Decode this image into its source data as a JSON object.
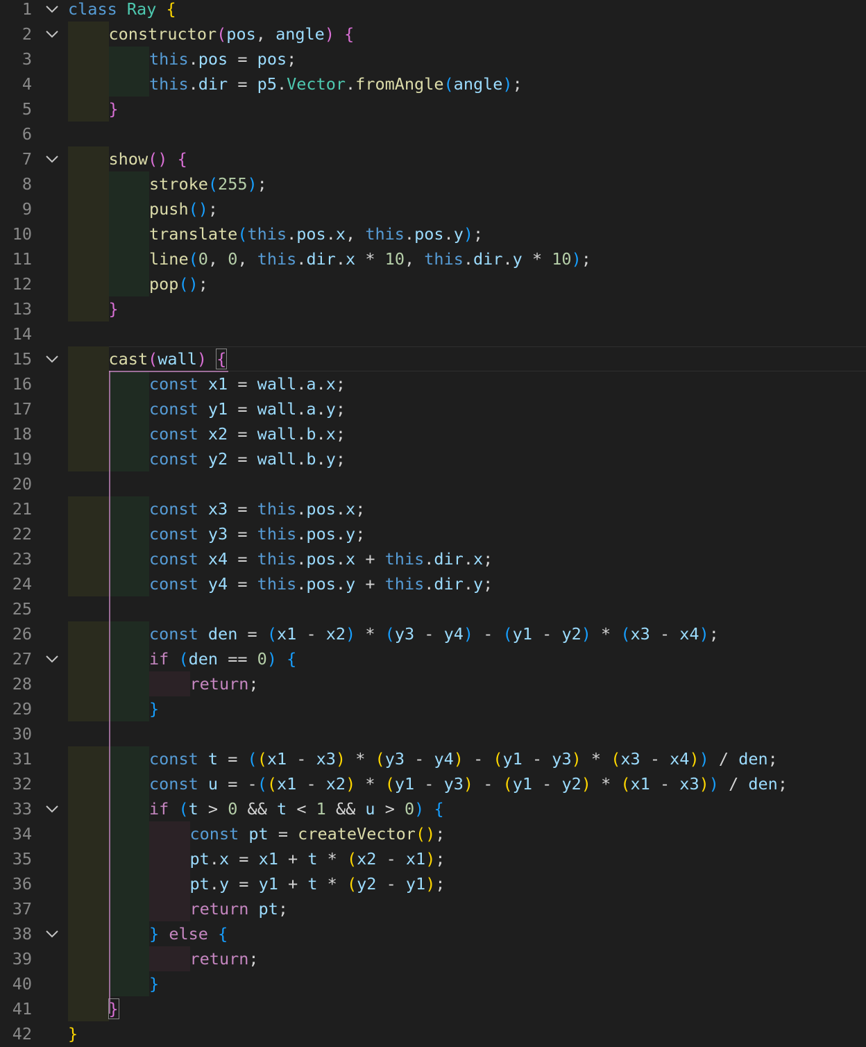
{
  "editor": {
    "lines": [
      {
        "n": "1",
        "fold": true,
        "indent": 0,
        "code": "class Ray {"
      },
      {
        "n": "2",
        "fold": true,
        "indent": 1,
        "code": "constructor(pos, angle) {"
      },
      {
        "n": "3",
        "fold": false,
        "indent": 2,
        "code": "this.pos = pos;"
      },
      {
        "n": "4",
        "fold": false,
        "indent": 2,
        "code": "this.dir = p5.Vector.fromAngle(angle);"
      },
      {
        "n": "5",
        "fold": false,
        "indent": 1,
        "code": "}"
      },
      {
        "n": "6",
        "fold": false,
        "indent": 0,
        "code": ""
      },
      {
        "n": "7",
        "fold": true,
        "indent": 1,
        "code": "show() {"
      },
      {
        "n": "8",
        "fold": false,
        "indent": 2,
        "code": "stroke(255);"
      },
      {
        "n": "9",
        "fold": false,
        "indent": 2,
        "code": "push();"
      },
      {
        "n": "10",
        "fold": false,
        "indent": 2,
        "code": "translate(this.pos.x, this.pos.y);"
      },
      {
        "n": "11",
        "fold": false,
        "indent": 2,
        "code": "line(0, 0, this.dir.x * 10, this.dir.y * 10);"
      },
      {
        "n": "12",
        "fold": false,
        "indent": 2,
        "code": "pop();"
      },
      {
        "n": "13",
        "fold": false,
        "indent": 1,
        "code": "}"
      },
      {
        "n": "14",
        "fold": false,
        "indent": 0,
        "code": ""
      },
      {
        "n": "15",
        "fold": true,
        "indent": 1,
        "code": "cast(wall) {"
      },
      {
        "n": "16",
        "fold": false,
        "indent": 2,
        "code": "const x1 = wall.a.x;"
      },
      {
        "n": "17",
        "fold": false,
        "indent": 2,
        "code": "const y1 = wall.a.y;"
      },
      {
        "n": "18",
        "fold": false,
        "indent": 2,
        "code": "const x2 = wall.b.x;"
      },
      {
        "n": "19",
        "fold": false,
        "indent": 2,
        "code": "const y2 = wall.b.y;"
      },
      {
        "n": "20",
        "fold": false,
        "indent": 0,
        "code": ""
      },
      {
        "n": "21",
        "fold": false,
        "indent": 2,
        "code": "const x3 = this.pos.x;"
      },
      {
        "n": "22",
        "fold": false,
        "indent": 2,
        "code": "const y3 = this.pos.y;"
      },
      {
        "n": "23",
        "fold": false,
        "indent": 2,
        "code": "const x4 = this.pos.x + this.dir.x;"
      },
      {
        "n": "24",
        "fold": false,
        "indent": 2,
        "code": "const y4 = this.pos.y + this.dir.y;"
      },
      {
        "n": "25",
        "fold": false,
        "indent": 0,
        "code": ""
      },
      {
        "n": "26",
        "fold": false,
        "indent": 2,
        "code": "const den = (x1 - x2) * (y3 - y4) - (y1 - y2) * (x3 - x4);"
      },
      {
        "n": "27",
        "fold": true,
        "indent": 2,
        "code": "if (den == 0) {"
      },
      {
        "n": "28",
        "fold": false,
        "indent": 3,
        "code": "return;"
      },
      {
        "n": "29",
        "fold": false,
        "indent": 2,
        "code": "}"
      },
      {
        "n": "30",
        "fold": false,
        "indent": 0,
        "code": ""
      },
      {
        "n": "31",
        "fold": false,
        "indent": 2,
        "code": "const t = ((x1 - x3) * (y3 - y4) - (y1 - y3) * (x3 - x4)) / den;"
      },
      {
        "n": "32",
        "fold": false,
        "indent": 2,
        "code": "const u = -((x1 - x2) * (y1 - y3) - (y1 - y2) * (x1 - x3)) / den;"
      },
      {
        "n": "33",
        "fold": true,
        "indent": 2,
        "code": "if (t > 0 && t < 1 && u > 0) {"
      },
      {
        "n": "34",
        "fold": false,
        "indent": 3,
        "code": "const pt = createVector();"
      },
      {
        "n": "35",
        "fold": false,
        "indent": 3,
        "code": "pt.x = x1 + t * (x2 - x1);"
      },
      {
        "n": "36",
        "fold": false,
        "indent": 3,
        "code": "pt.y = y1 + t * (y2 - y1);"
      },
      {
        "n": "37",
        "fold": false,
        "indent": 3,
        "code": "return pt;"
      },
      {
        "n": "38",
        "fold": true,
        "indent": 2,
        "code": "} else {"
      },
      {
        "n": "39",
        "fold": false,
        "indent": 3,
        "code": "return;"
      },
      {
        "n": "40",
        "fold": false,
        "indent": 2,
        "code": "}"
      },
      {
        "n": "41",
        "fold": false,
        "indent": 1,
        "code": "}"
      },
      {
        "n": "42",
        "fold": false,
        "indent": 0,
        "code": "}"
      }
    ]
  },
  "icons": {
    "fold": "chevron-down-icon"
  },
  "colors": {
    "background": "#1e1e1e",
    "line_number": "#8a8a8a",
    "keyword": "#569cd6",
    "control": "#c586c0",
    "class_name": "#4ec9b0",
    "function": "#dcdcaa",
    "variable": "#9cdcfe",
    "this": "#4fc1ff",
    "number": "#b5cea8",
    "bracket_1": "#ffd700",
    "bracket_2": "#da70d6",
    "bracket_3": "#179fff"
  }
}
